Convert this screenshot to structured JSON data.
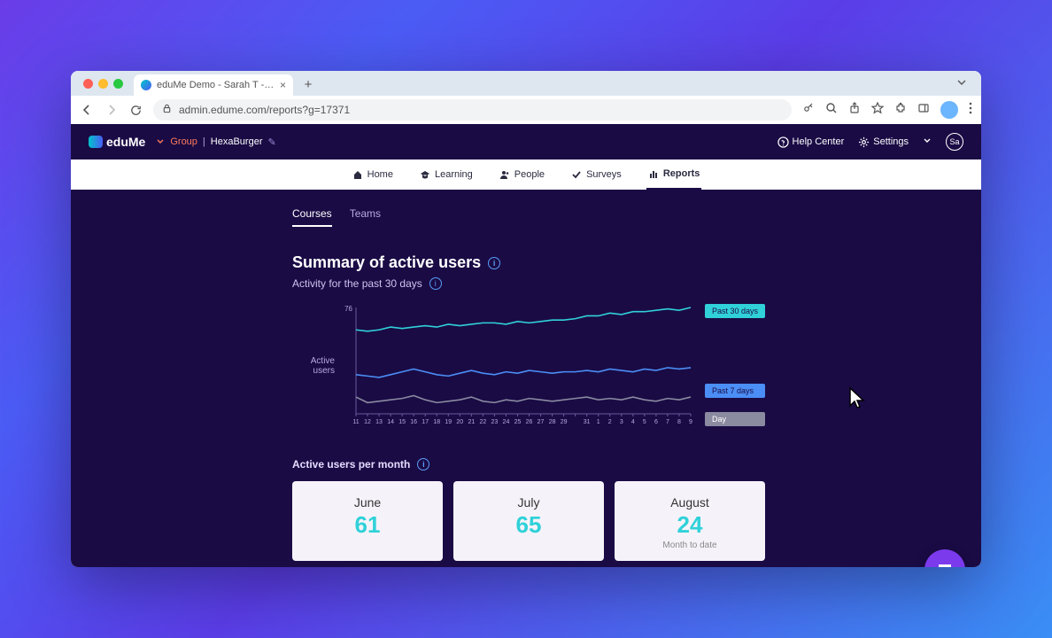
{
  "browser": {
    "tab_title": "eduMe Demo - Sarah T - eduM",
    "url": "admin.edume.com/reports?g=17371",
    "avatar_letter": ""
  },
  "header": {
    "brand": "eduMe",
    "group_prefix": "Group",
    "group_name": "HexaBurger",
    "help_center": "Help Center",
    "settings": "Settings",
    "user_initials": "Sa"
  },
  "nav": {
    "home": "Home",
    "learning": "Learning",
    "people": "People",
    "surveys": "Surveys",
    "reports": "Reports"
  },
  "subtabs": {
    "courses": "Courses",
    "teams": "Teams"
  },
  "page": {
    "title": "Summary of active users",
    "subtitle": "Activity for the past 30 days",
    "ylabel": "Active users",
    "ymax": "76"
  },
  "legends": {
    "past30": "Past 30 days",
    "past7": "Past 7 days",
    "day": "Day"
  },
  "section2": "Active users per month",
  "months": [
    {
      "name": "June",
      "value": "61",
      "sub": ""
    },
    {
      "name": "July",
      "value": "65",
      "sub": ""
    },
    {
      "name": "August",
      "value": "24",
      "sub": "Month to date"
    }
  ],
  "chart_data": {
    "type": "line",
    "title": "Summary of active users",
    "xlabel": "Day",
    "ylabel": "Active users",
    "ylim": [
      0,
      76
    ],
    "categories": [
      "11",
      "12",
      "13",
      "14",
      "15",
      "16",
      "17",
      "18",
      "19",
      "20",
      "21",
      "22",
      "23",
      "24",
      "25",
      "26",
      "27",
      "28",
      "29",
      "",
      "31",
      "1",
      "2",
      "3",
      "4",
      "5",
      "6",
      "7",
      "8",
      "9"
    ],
    "series": [
      {
        "name": "Past 30 days",
        "color": "#30d1d9",
        "values": [
          60,
          59,
          60,
          62,
          61,
          62,
          63,
          62,
          64,
          63,
          64,
          65,
          65,
          64,
          66,
          65,
          66,
          67,
          67,
          68,
          70,
          70,
          72,
          71,
          73,
          73,
          74,
          75,
          74,
          76
        ]
      },
      {
        "name": "Past 7 days",
        "color": "#4b8ef5",
        "values": [
          28,
          27,
          26,
          28,
          30,
          32,
          30,
          28,
          27,
          29,
          31,
          29,
          28,
          30,
          29,
          31,
          30,
          29,
          30,
          30,
          31,
          30,
          32,
          31,
          30,
          32,
          31,
          33,
          32,
          33
        ]
      },
      {
        "name": "Day",
        "color": "#8a8aa0",
        "values": [
          12,
          8,
          9,
          10,
          11,
          13,
          10,
          8,
          9,
          10,
          12,
          9,
          8,
          10,
          9,
          11,
          10,
          9,
          10,
          11,
          12,
          10,
          11,
          10,
          12,
          10,
          9,
          11,
          10,
          12
        ]
      }
    ]
  }
}
